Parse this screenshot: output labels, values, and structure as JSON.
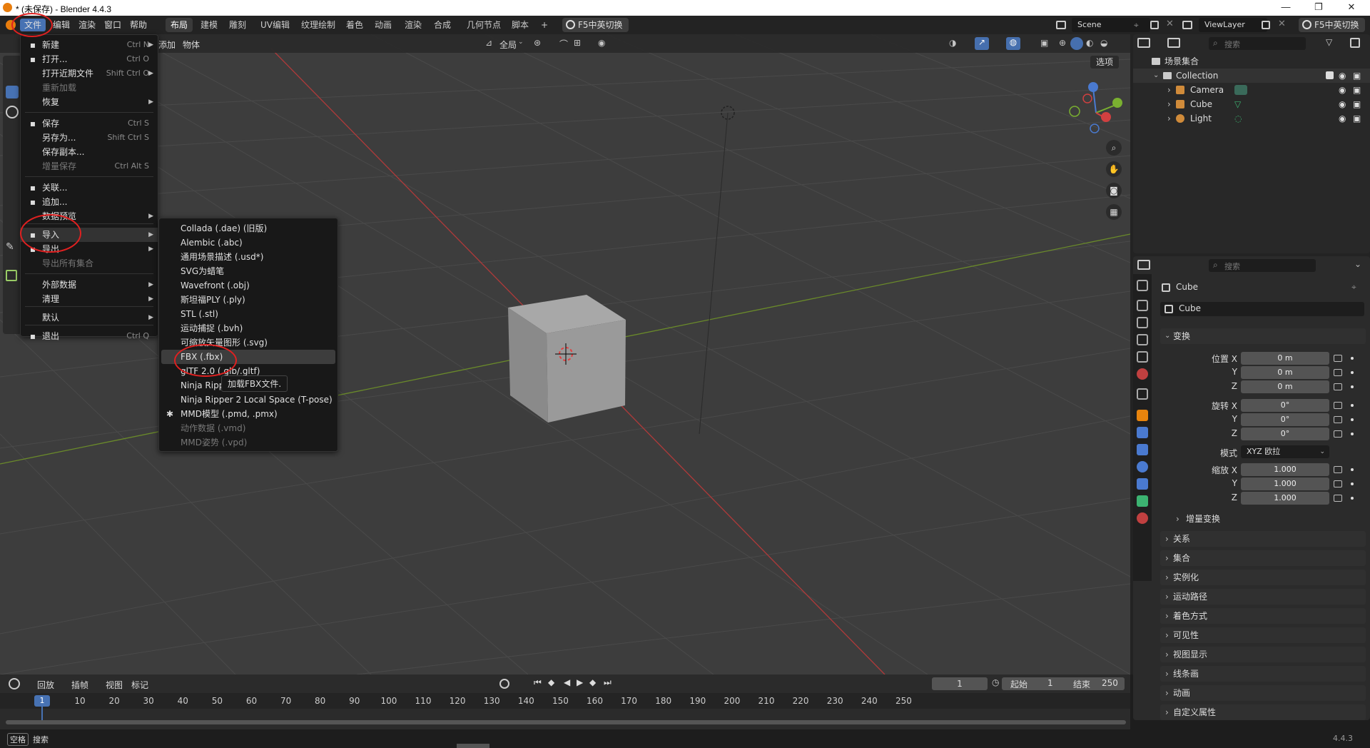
{
  "window": {
    "title": "* (未保存) - Blender 4.4.3",
    "minimize": "—",
    "maximize": "❐",
    "close": "✕"
  },
  "topmenu": [
    "文件",
    "编辑",
    "渲染",
    "窗口",
    "帮助"
  ],
  "workspaces": [
    "布局",
    "建模",
    "雕刻",
    "UV编辑",
    "纹理绘制",
    "着色",
    "动画",
    "渲染",
    "合成",
    "几何节点",
    "脚本",
    "+"
  ],
  "ime_toggle": "F5中英切换",
  "scene": "Scene",
  "viewlayer": "ViewLayer",
  "viewport_header": {
    "add": "添加",
    "object": "物体",
    "orientation": "全局",
    "options": "选项"
  },
  "file_menu": {
    "items": [
      {
        "label": "新建",
        "shortcut": "Ctrl N",
        "arrow": true,
        "icon": "new-file-icon"
      },
      {
        "label": "打开...",
        "shortcut": "Ctrl O",
        "icon": "folder-icon"
      },
      {
        "label": "打开近期文件",
        "shortcut": "Shift Ctrl O",
        "arrow": true
      },
      {
        "label": "重新加载",
        "disabled": true
      },
      {
        "label": "恢复",
        "arrow": true
      },
      {
        "label": "保存",
        "shortcut": "Ctrl S",
        "icon": "save-icon"
      },
      {
        "label": "另存为...",
        "shortcut": "Shift Ctrl S"
      },
      {
        "label": "保存副本..."
      },
      {
        "label": "增量保存",
        "shortcut": "Ctrl Alt S",
        "disabled": true
      },
      {
        "label": "关联...",
        "icon": "link-icon"
      },
      {
        "label": "追加...",
        "icon": "append-icon"
      },
      {
        "label": "数据预览",
        "arrow": true
      },
      {
        "label": "导入",
        "arrow": true,
        "icon": "import-icon",
        "highlight": true
      },
      {
        "label": "导出",
        "arrow": true,
        "icon": "export-icon"
      },
      {
        "label": "导出所有集合",
        "disabled": true
      },
      {
        "label": "外部数据",
        "arrow": true
      },
      {
        "label": "清理",
        "arrow": true
      },
      {
        "label": "默认",
        "arrow": true
      },
      {
        "label": "退出",
        "shortcut": "Ctrl Q",
        "icon": "power-icon"
      }
    ]
  },
  "import_menu": {
    "items": [
      {
        "label": "Collada (.dae) (旧版)"
      },
      {
        "label": "Alembic (.abc)"
      },
      {
        "label": "通用场景描述 (.usd*)"
      },
      {
        "label": "SVG为蜡笔"
      },
      {
        "label": "Wavefront (.obj)"
      },
      {
        "label": "斯坦福PLY (.ply)"
      },
      {
        "label": "STL (.stl)"
      },
      {
        "label": "运动捕捉 (.bvh)"
      },
      {
        "label": "可缩放矢量图形 (.svg)"
      },
      {
        "label": "FBX (.fbx)",
        "highlight": true
      },
      {
        "label": "glTF 2.0 (.glb/.gltf)"
      },
      {
        "label": "Ninja Ripp"
      },
      {
        "label": "Ninja Ripper 2 Local Space (T-pose)"
      },
      {
        "label": "MMD模型 (.pmd, .pmx)",
        "icon": "mmd-icon"
      },
      {
        "label": "动作数据 (.vmd)",
        "disabled": true
      },
      {
        "label": "MMD姿势 (.vpd)",
        "disabled": true
      }
    ],
    "tooltip": "加载FBX文件."
  },
  "outliner": {
    "search_placeholder": "搜索",
    "scene_collection": "场景集合",
    "collection": "Collection",
    "objects": [
      "Camera",
      "Cube",
      "Light"
    ]
  },
  "properties": {
    "search_placeholder": "搜索",
    "object_name": "Cube",
    "datablock": "Cube",
    "transform": "变换",
    "location_label": "位置 X",
    "rotation_label": "旋转 X",
    "scale_label": "缩放 X",
    "axis_y": "Y",
    "axis_z": "Z",
    "loc": [
      "0 m",
      "0 m",
      "0 m"
    ],
    "rot": [
      "0°",
      "0°",
      "0°"
    ],
    "mode_label": "模式",
    "mode_value": "XYZ 欧拉",
    "scale": [
      "1.000",
      "1.000",
      "1.000"
    ],
    "delta": "增量变换",
    "sections": [
      "关系",
      "集合",
      "实例化",
      "运动路径",
      "着色方式",
      "可见性",
      "视图显示",
      "线条画",
      "动画",
      "自定义属性"
    ]
  },
  "timeline": {
    "menus": [
      "回放",
      "插帧",
      "视图",
      "标记"
    ],
    "current_frame": "1",
    "start_label": "起始",
    "start": "1",
    "end_label": "结束",
    "end": "250",
    "ticks": [
      "10",
      "20",
      "30",
      "40",
      "50",
      "60",
      "70",
      "80",
      "90",
      "100",
      "110",
      "120",
      "130",
      "140",
      "150",
      "160",
      "170",
      "180",
      "190",
      "200",
      "210",
      "220",
      "230",
      "240",
      "250"
    ],
    "playhead": "1"
  },
  "status": {
    "key": "空格",
    "action": "搜索",
    "version": "4.4.3"
  }
}
